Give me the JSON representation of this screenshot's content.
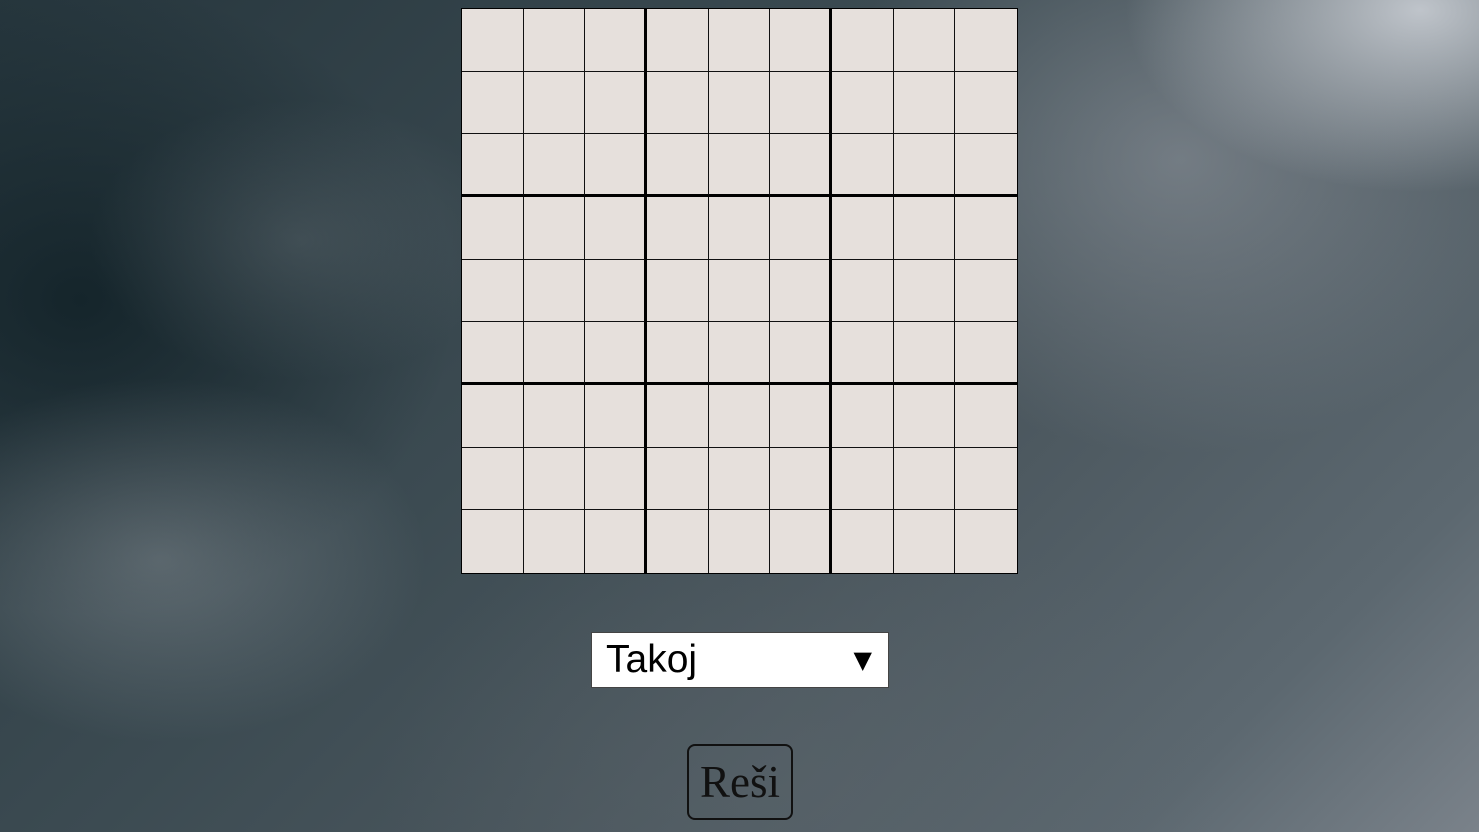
{
  "sudoku": {
    "cells": [
      [
        "",
        "",
        "",
        "",
        "",
        "",
        "",
        "",
        ""
      ],
      [
        "",
        "",
        "",
        "",
        "",
        "",
        "",
        "",
        ""
      ],
      [
        "",
        "",
        "",
        "",
        "",
        "",
        "",
        "",
        ""
      ],
      [
        "",
        "",
        "",
        "",
        "",
        "",
        "",
        "",
        ""
      ],
      [
        "",
        "",
        "",
        "",
        "",
        "",
        "",
        "",
        ""
      ],
      [
        "",
        "",
        "",
        "",
        "",
        "",
        "",
        "",
        ""
      ],
      [
        "",
        "",
        "",
        "",
        "",
        "",
        "",
        "",
        ""
      ],
      [
        "",
        "",
        "",
        "",
        "",
        "",
        "",
        "",
        ""
      ],
      [
        "",
        "",
        "",
        "",
        "",
        "",
        "",
        "",
        ""
      ]
    ]
  },
  "speed_select": {
    "value": "Takoj",
    "arrow_icon": "▼"
  },
  "solve_button": {
    "label": "Reši"
  },
  "colors": {
    "cell_background": "#e6e0dc",
    "grid_lines": "#000000",
    "select_background": "#ffffff"
  }
}
